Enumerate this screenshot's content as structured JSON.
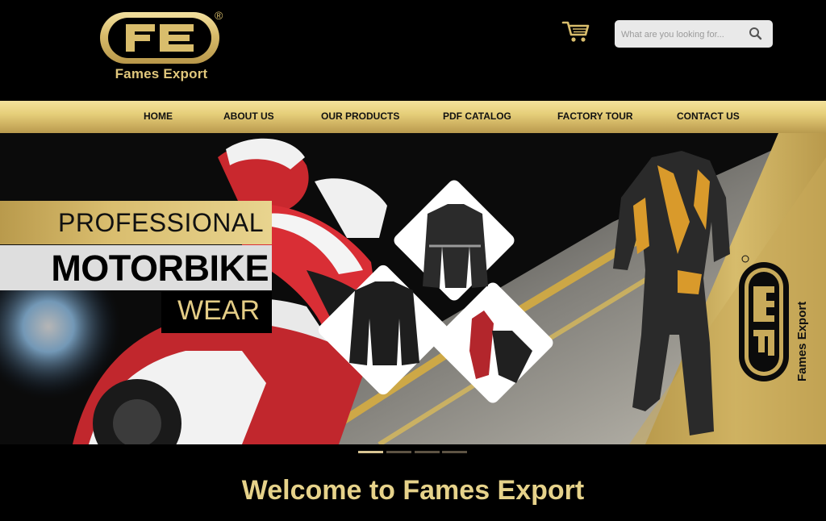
{
  "header": {
    "logo_name": "Fames Export",
    "logo_mark": "FE",
    "logo_reg": "®",
    "cart_icon": "shopping-cart-icon",
    "search": {
      "placeholder": "What are you looking for...",
      "value": "",
      "icon": "search-icon"
    }
  },
  "nav": {
    "items": [
      {
        "label": "HOME"
      },
      {
        "label": "ABOUT US"
      },
      {
        "label": "OUR PRODUCTS"
      },
      {
        "label": "PDF CATALOG"
      },
      {
        "label": "FACTORY TOUR"
      },
      {
        "label": "CONTACT US"
      }
    ]
  },
  "hero": {
    "line1": "PROFESSIONAL",
    "line2": "MOTORBIKE",
    "line3": "WEAR",
    "side_logo_name": "Fames Export",
    "slides": 4,
    "active_slide": 1
  },
  "welcome": "Welcome to Fames Export",
  "colors": {
    "gold": "#d9bd6e",
    "gold_light": "#f3e29c",
    "black": "#000000"
  }
}
